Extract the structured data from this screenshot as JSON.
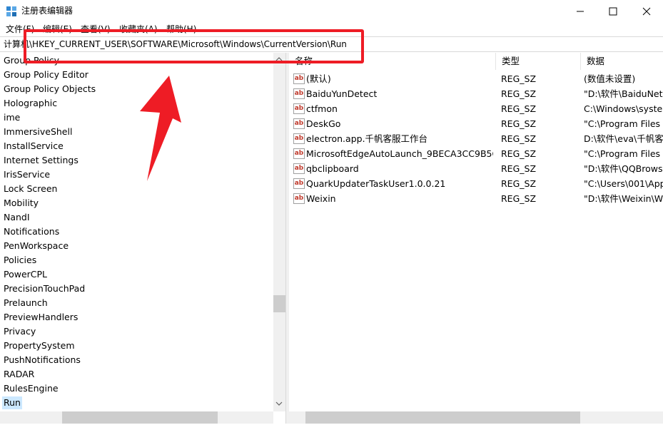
{
  "window": {
    "title": "注册表编辑器",
    "accent": "#0078d7"
  },
  "menu": [
    "文件(F)",
    "编辑(E)",
    "查看(V)",
    "收藏夹(A)",
    "帮助(H)"
  ],
  "address": {
    "path": "计算机\\HKEY_CURRENT_USER\\SOFTWARE\\Microsoft\\Windows\\CurrentVersion\\Run"
  },
  "annotation": {
    "color": "#ee1c25"
  },
  "tree": {
    "items": [
      "Group Policy",
      "Group Policy Editor",
      "Group Policy Objects",
      "Holographic",
      "ime",
      "ImmersiveShell",
      "InstallService",
      "Internet Settings",
      "IrisService",
      "Lock Screen",
      "Mobility",
      "NandI",
      "Notifications",
      "PenWorkspace",
      "Policies",
      "PowerCPL",
      "PrecisionTouchPad",
      "Prelaunch",
      "PreviewHandlers",
      "Privacy",
      "PropertySystem",
      "PushNotifications",
      "RADAR",
      "RulesEngine",
      "Run"
    ],
    "selected": "Run"
  },
  "columns": {
    "name": "名称",
    "type": "类型",
    "data": "数据"
  },
  "values": [
    {
      "name": "(默认)",
      "type": "REG_SZ",
      "data": "(数值未设置)"
    },
    {
      "name": "BaiduYunDetect",
      "type": "REG_SZ",
      "data": "\"D:\\软件\\BaiduNet"
    },
    {
      "name": "ctfmon",
      "type": "REG_SZ",
      "data": "C:\\Windows\\syste"
    },
    {
      "name": "DeskGo",
      "type": "REG_SZ",
      "data": "\"C:\\Program Files"
    },
    {
      "name": "electron.app.千帆客服工作台",
      "type": "REG_SZ",
      "data": "D:\\软件\\eva\\千帆客"
    },
    {
      "name": "MicrosoftEdgeAutoLaunch_9BECA3CC9B5C...",
      "type": "REG_SZ",
      "data": "\"C:\\Program Files"
    },
    {
      "name": "qbclipboard",
      "type": "REG_SZ",
      "data": "\"D:\\软件\\QQBrows"
    },
    {
      "name": "QuarkUpdaterTaskUser1.0.0.21",
      "type": "REG_SZ",
      "data": "\"C:\\Users\\001\\App"
    },
    {
      "name": "Weixin",
      "type": "REG_SZ",
      "data": "\"D:\\软件\\Weixin\\W"
    }
  ],
  "icons": {
    "app": "registry-cube-icon",
    "value": "string-value-icon",
    "value_glyph": "ab"
  }
}
